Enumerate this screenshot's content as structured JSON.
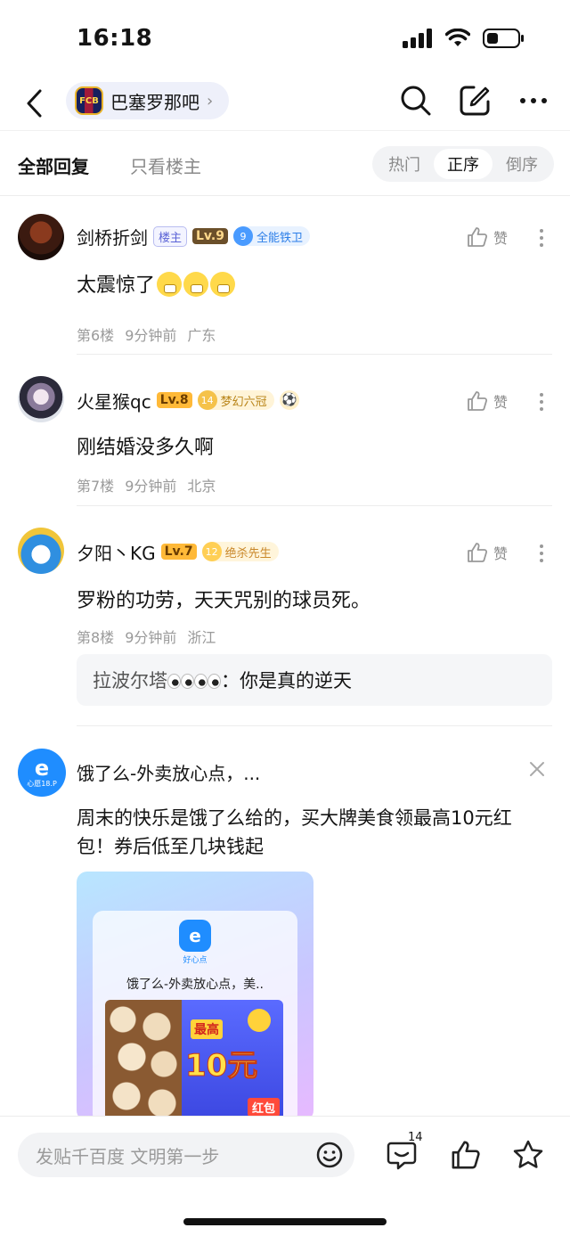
{
  "status_bar": {
    "time": "16:18"
  },
  "nav": {
    "forum_name": "巴塞罗那吧",
    "forum_logo_text": "FCB"
  },
  "tabs": {
    "all_replies": "全部回复",
    "op_only": "只看楼主",
    "sort_options": [
      "热门",
      "正序",
      "倒序"
    ],
    "active_sort": "正序"
  },
  "posts": [
    {
      "username": "剑桥折剑",
      "op_badge": "楼主",
      "level": "Lv.9",
      "honor_num": "9",
      "honor_title": "全能铁卫",
      "content": "太震惊了",
      "floor": "第6楼",
      "time": "9分钟前",
      "location": "广东",
      "like_label": "赞"
    },
    {
      "username": "火星猴qc",
      "level": "Lv.8",
      "honor_num": "14",
      "honor_title": "梦幻六冠",
      "content": "刚结婚没多久啊",
      "floor": "第7楼",
      "time": "9分钟前",
      "location": "北京",
      "like_label": "赞"
    },
    {
      "username": "夕阳丶KG",
      "level": "Lv.7",
      "honor_num": "12",
      "honor_title": "绝杀先生",
      "content": "罗粉的功劳，天天咒别的球员死。",
      "floor": "第8楼",
      "time": "9分钟前",
      "location": "浙江",
      "like_label": "赞",
      "sub_reply": {
        "name": "拉波尔塔",
        "text": "：你是真的逆天"
      }
    }
  ],
  "ad": {
    "avatar_text": "饿了么",
    "avatar_sub": "心愿18.P",
    "title": "饿了么-外卖放心点，...",
    "text": "周末的快乐是饿了么给的，买大牌美食领最高10元红包！券后低至几块钱起",
    "card_logo": "e",
    "card_sub": "好心点",
    "card_title": "饿了么-外卖放心点，美..",
    "promo_top": "最高",
    "promo_amount": "10元",
    "promo_bottom": "红包"
  },
  "bottom_bar": {
    "input_placeholder": "发贴千百度 文明第一步",
    "comment_count": "14"
  }
}
